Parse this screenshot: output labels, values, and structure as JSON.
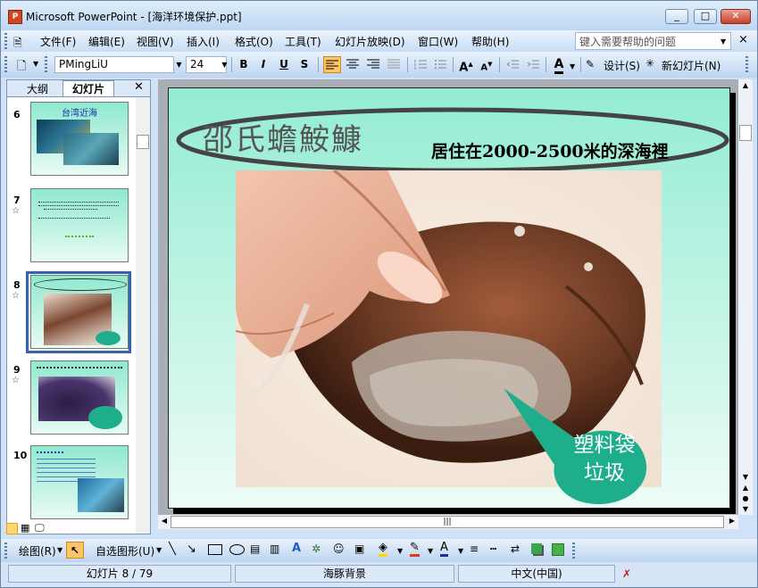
{
  "window": {
    "title": "Microsoft PowerPoint - [海洋环境保护.ppt]",
    "app_icon_text": "P",
    "buttons": {
      "minimize": "_",
      "maximize": "□",
      "close": "✕"
    }
  },
  "menubar": {
    "items": [
      "文件(F)",
      "编辑(E)",
      "视图(V)",
      "插入(I)",
      "格式(O)",
      "工具(T)",
      "幻灯片放映(D)",
      "窗口(W)",
      "帮助(H)"
    ],
    "help_placeholder": "键入需要帮助的问题",
    "close_glyph": "×"
  },
  "toolbar": {
    "font_name": "PMingLiU",
    "font_size": "24",
    "bold": "B",
    "italic": "I",
    "underline": "U",
    "shadow": "S",
    "design_label": "设计(S)",
    "new_slide_label": "新幻灯片(N)"
  },
  "left_pane": {
    "tab_outline": "大纲",
    "tab_slides": "幻灯片",
    "close_glyph": "✕",
    "thumbnails": [
      {
        "number": "6",
        "title": "台湾近海",
        "has_star": false
      },
      {
        "number": "7",
        "title": "",
        "has_star": true
      },
      {
        "number": "8",
        "title": "",
        "has_star": true,
        "selected": true
      },
      {
        "number": "9",
        "title": "",
        "has_star": true
      },
      {
        "number": "10",
        "title": "",
        "has_star": false
      }
    ],
    "star_glyph": "☆"
  },
  "slide": {
    "title": "邵氏蟾鮟鱇",
    "subtitle": "居住在2000-2500米的深海裡",
    "callout_line1": "塑料袋",
    "callout_line2": "垃圾"
  },
  "drawbar": {
    "draw_label": "绘图(R)",
    "autoshapes_label": "自选图形(U)"
  },
  "statusbar": {
    "slide_position": "幻灯片 8 / 79",
    "design_template": "海豚背景",
    "language": "中文(中国)"
  },
  "colors": {
    "slide_top": "#93ecd3",
    "slide_bottom": "#edfcf6",
    "callout_fill": "#1fae8c",
    "selection": "#3463b0"
  }
}
